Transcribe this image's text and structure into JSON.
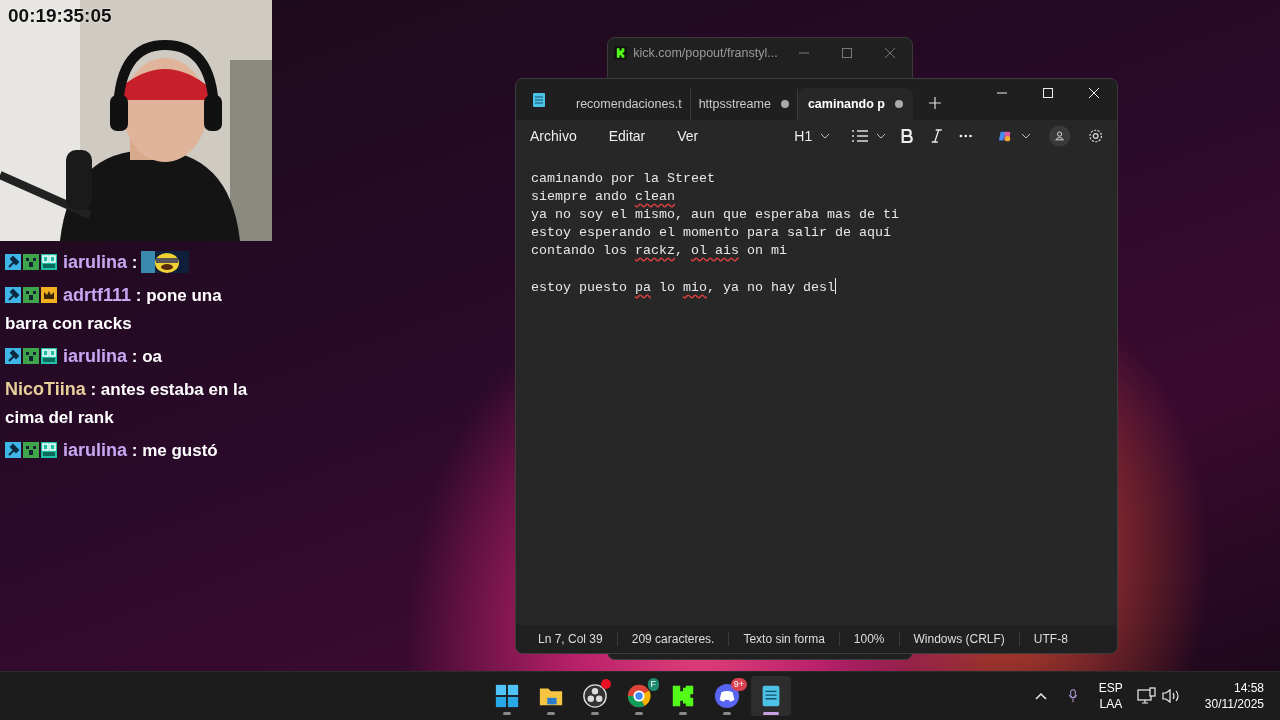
{
  "stream_overlay": {
    "timer": "00:19:35:05"
  },
  "chat": [
    {
      "badges": [
        {
          "kind": "hammer"
        },
        {
          "kind": "creeper"
        },
        {
          "kind": "og"
        }
      ],
      "user": "iarulina",
      "color": "#c7a6f2",
      "kind": "emote",
      "message": ":"
    },
    {
      "badges": [
        {
          "kind": "hammer"
        },
        {
          "kind": "creeper"
        },
        {
          "kind": "crown"
        }
      ],
      "user": "adrtf111",
      "color": "#c7a6f2",
      "kind": "text",
      "message": ": pone una barra con racks"
    },
    {
      "badges": [
        {
          "kind": "hammer"
        },
        {
          "kind": "creeper"
        },
        {
          "kind": "og"
        }
      ],
      "user": "iarulina",
      "color": "#c7a6f2",
      "kind": "text",
      "message": ": oa"
    },
    {
      "user": "NicoTiina",
      "color": "#e8cf9a",
      "kind": "text",
      "message": ": antes estaba en la cima del rank"
    },
    {
      "badges": [
        {
          "kind": "hammer"
        },
        {
          "kind": "creeper"
        },
        {
          "kind": "og"
        }
      ],
      "user": "iarulina",
      "color": "#c7a6f2",
      "kind": "text",
      "message": ": me gustó"
    }
  ],
  "browser_window": {
    "title": "kick.com/popout/franstyl..."
  },
  "notepad": {
    "tabs": [
      {
        "label": "recomendaciones.t",
        "unsaved": false,
        "selected": false
      },
      {
        "label": "httpsstreame",
        "unsaved": true,
        "selected": false
      },
      {
        "label": "caminando p",
        "unsaved": true,
        "selected": true
      }
    ],
    "menu": [
      "Archivo",
      "Editar",
      "Ver"
    ],
    "heading_button": "H1",
    "lines": [
      {
        "kind": "text",
        "segments": [
          {
            "text": "caminando por la Street",
            "misspelled": false
          }
        ]
      },
      {
        "kind": "text",
        "segments": [
          {
            "text": "siempre ando ",
            "misspelled": false
          },
          {
            "text": "clean",
            "misspelled": true
          }
        ]
      },
      {
        "kind": "text",
        "segments": [
          {
            "text": "ya no soy el mismo, aun que esperaba mas de ti",
            "misspelled": false
          }
        ]
      },
      {
        "kind": "text",
        "segments": [
          {
            "text": "estoy esperando el momento para salir de aquí",
            "misspelled": false
          }
        ]
      },
      {
        "kind": "text",
        "segments": [
          {
            "text": "contando los ",
            "misspelled": false
          },
          {
            "text": "rackz",
            "misspelled": true
          },
          {
            "text": ", ",
            "misspelled": false
          },
          {
            "text": "ol ais",
            "misspelled": true
          },
          {
            "text": " on mi",
            "misspelled": false
          }
        ]
      },
      {
        "kind": "blank"
      },
      {
        "kind": "text",
        "segments": [
          {
            "text": "estoy puesto ",
            "misspelled": false
          },
          {
            "text": "pa",
            "misspelled": true
          },
          {
            "text": " lo ",
            "misspelled": false
          },
          {
            "text": "mio",
            "misspelled": true
          },
          {
            "text": ", ya no hay desl",
            "misspelled": false
          }
        ]
      }
    ],
    "status_bar": [
      "Ln 7, Col 39",
      "209 caracteres.",
      "Texto sin forma",
      "100%",
      "Windows (CRLF)",
      "UTF-8"
    ]
  },
  "taskbar": {
    "apps": [
      {
        "kind": "start"
      },
      {
        "kind": "folder"
      },
      {
        "kind": "recorder",
        "notification_dot": true
      },
      {
        "kind": "browser",
        "badge": "F"
      },
      {
        "kind": "kick"
      },
      {
        "kind": "chat",
        "badge": "9+"
      },
      {
        "kind": "notepad",
        "selected": true
      }
    ],
    "language": [
      "ESP",
      "LAA"
    ],
    "time": "14:58",
    "date": "30/11/2025"
  }
}
